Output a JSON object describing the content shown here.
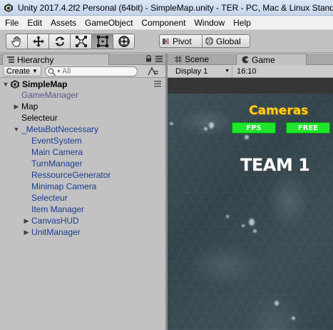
{
  "window": {
    "title": "Unity 2017.4.2f2 Personal (64bit) - SimpleMap.unity - TER - PC, Mac & Linux Standal"
  },
  "menu": [
    "File",
    "Edit",
    "Assets",
    "GameObject",
    "Component",
    "Window",
    "Help"
  ],
  "toolbar": {
    "tools": [
      {
        "name": "hand-tool",
        "icon": "hand-icon",
        "active": false
      },
      {
        "name": "move-tool",
        "icon": "move-arrows-icon",
        "active": false
      },
      {
        "name": "rotate-tool",
        "icon": "rotate-icon",
        "active": false
      },
      {
        "name": "scale-tool",
        "icon": "scale-icon",
        "active": false
      },
      {
        "name": "rect-tool",
        "icon": "rect-icon",
        "active": true
      },
      {
        "name": "transform-tool",
        "icon": "transform-icon",
        "active": false
      }
    ],
    "pivot_label": "Pivot",
    "global_label": "Global"
  },
  "hierarchy": {
    "tab_label": "Hierarchy",
    "create_label": "Create",
    "search_placeholder": "All",
    "scene_name": "SimpleMap",
    "items": [
      {
        "label": "GameManager",
        "style": "grey"
      },
      {
        "label": "Map",
        "style": "normal"
      },
      {
        "label": "Selecteur",
        "style": "normal"
      },
      {
        "label": "_MetaBotNecessary",
        "style": "blue"
      },
      {
        "label": "EventSystem",
        "style": "blue"
      },
      {
        "label": "Main Camera",
        "style": "blue"
      },
      {
        "label": "TurnManager",
        "style": "blue"
      },
      {
        "label": "RessourceGenerator",
        "style": "blue"
      },
      {
        "label": "Minimap Camera",
        "style": "blue"
      },
      {
        "label": "Selecteur",
        "style": "blue"
      },
      {
        "label": "Item Manager",
        "style": "blue"
      },
      {
        "label": "CanvasHUD",
        "style": "blue"
      },
      {
        "label": "UnitManager",
        "style": "blue"
      }
    ]
  },
  "views": {
    "scene_tab_label": "Scene",
    "game_tab_label": "Game",
    "display_label": "Display 1",
    "aspect_label": "16:10"
  },
  "game": {
    "cameras_title": "Cameras",
    "fps_button": "FPS",
    "free_button": "FREE",
    "team_label": "TEAM 1"
  }
}
